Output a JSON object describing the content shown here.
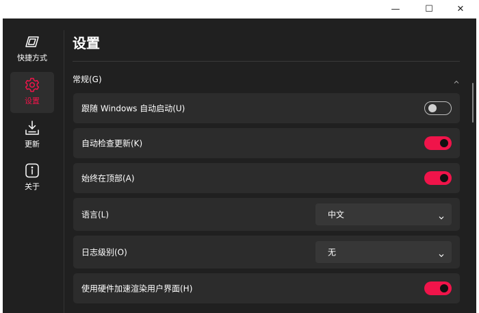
{
  "window": {
    "controls": {
      "minimize": "—",
      "maximize": "☐",
      "close": "✕"
    }
  },
  "nav": {
    "items": [
      {
        "label": "快捷方式",
        "icon": "shortcut-icon",
        "active": false
      },
      {
        "label": "设置",
        "icon": "gear-icon",
        "active": true
      },
      {
        "label": "更新",
        "icon": "download-icon",
        "active": false
      },
      {
        "label": "关于",
        "icon": "info-icon",
        "active": false
      }
    ]
  },
  "page": {
    "title": "设置"
  },
  "section": {
    "label": "常规(G)",
    "expanded": true
  },
  "settings": [
    {
      "label": "跟随 Windows 自动启动(U)",
      "type": "toggle",
      "on": false
    },
    {
      "label": "自动检查更新(K)",
      "type": "toggle",
      "on": true
    },
    {
      "label": "始终在顶部(A)",
      "type": "toggle",
      "on": true
    },
    {
      "label": "语言(L)",
      "type": "select",
      "value": "中文"
    },
    {
      "label": "日志级别(O)",
      "type": "select",
      "value": "无"
    },
    {
      "label": "使用硬件加速渲染用户界面(H)",
      "type": "toggle",
      "on": true
    }
  ],
  "colors": {
    "accent": "#f0144a",
    "background": "#202020",
    "card": "#2c2c2c",
    "select": "#373737"
  }
}
